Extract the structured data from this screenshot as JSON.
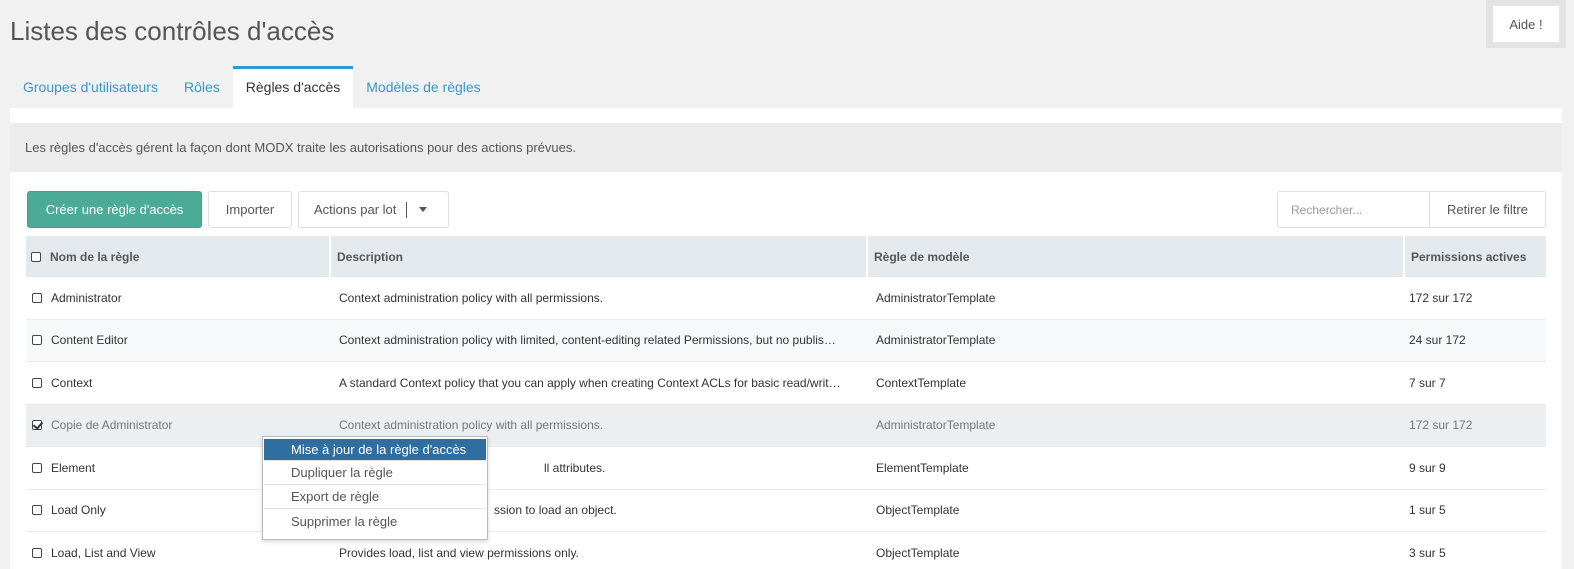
{
  "page": {
    "title": "Listes des contrôles d'accès",
    "help_label": "Aide !"
  },
  "tabs": [
    {
      "label": "Groupes d'utilisateurs",
      "active": false
    },
    {
      "label": "Rôles",
      "active": false
    },
    {
      "label": "Règles d'accès",
      "active": true
    },
    {
      "label": "Modèles de règles",
      "active": false
    }
  ],
  "intro": "Les règles d'accès gérent la façon dont MODX traite les autorisations pour des actions prévues.",
  "toolbar": {
    "create_label": "Créer une règle d'accès",
    "import_label": "Importer",
    "batch_label": "Actions par lot",
    "search_placeholder": "Rechercher...",
    "clear_filter_label": "Retirer le filtre"
  },
  "grid": {
    "columns": [
      "Nom de la règle",
      "Description",
      "Règle de modèle",
      "Permissions actives"
    ],
    "rows": [
      {
        "name": "Administrator",
        "description": "Context administration policy with all permissions.",
        "template": "AdministratorTemplate",
        "permissions": "172 sur 172",
        "checked": false
      },
      {
        "name": "Content Editor",
        "description": "Context administration policy with limited, content-editing related Permissions, but no publis…",
        "template": "AdministratorTemplate",
        "permissions": "24 sur 172",
        "checked": false
      },
      {
        "name": "Context",
        "description": "A standard Context policy that you can apply when creating Context ACLs for basic read/writ…",
        "template": "ContextTemplate",
        "permissions": "7 sur 7",
        "checked": false
      },
      {
        "name": "Copie de Administrator",
        "description": "Context administration policy with all permissions.",
        "template": "AdministratorTemplate",
        "permissions": "172 sur 172",
        "checked": true
      },
      {
        "name": "Element",
        "description": "ll attributes.",
        "template": "ElementTemplate",
        "permissions": "9 sur 9",
        "checked": false
      },
      {
        "name": "Load Only",
        "description": "ssion to load an object.",
        "template": "ObjectTemplate",
        "permissions": "1 sur 5",
        "checked": false
      },
      {
        "name": "Load, List and View",
        "description": "Provides load, list and view permissions only.",
        "template": "ObjectTemplate",
        "permissions": "3 sur 5",
        "checked": false
      }
    ]
  },
  "context_menu": [
    {
      "label": "Mise à jour de la règle d'accès",
      "active": true
    },
    {
      "label": "Dupliquer la règle",
      "active": false
    },
    {
      "label": "Export de règle",
      "active": false
    },
    {
      "label": "Supprimer la règle",
      "active": false
    }
  ]
}
